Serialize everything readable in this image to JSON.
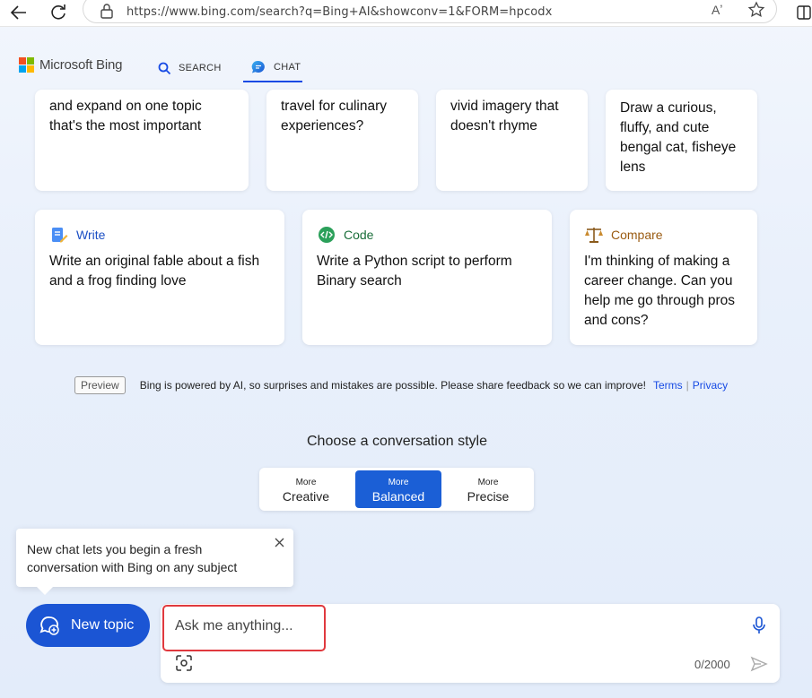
{
  "browser": {
    "url": "https://www.bing.com/search?q=Bing+AI&showconv=1&FORM=hpcodx",
    "read_aloud": "Aʼ"
  },
  "header": {
    "logo_text": "Microsoft Bing",
    "tabs": [
      {
        "label": "SEARCH"
      },
      {
        "label": "CHAT"
      }
    ]
  },
  "cards_top": [
    {
      "text": "and expand on one topic that's the most important"
    },
    {
      "text": "travel for culinary experiences?"
    },
    {
      "text": "vivid imagery that doesn't rhyme"
    },
    {
      "text": "Draw a curious, fluffy, and cute bengal cat, fisheye lens"
    }
  ],
  "cards": [
    {
      "category": "Write",
      "category_color": "#1b4fc4",
      "text": "Write an original fable about a fish and a frog finding love"
    },
    {
      "category": "Code",
      "category_color": "#1a6e3a",
      "text": "Write a Python script to perform Binary search"
    },
    {
      "category": "Compare",
      "category_color": "#9a5b12",
      "text": "I'm thinking of making a career change. Can you help me go through pros and cons?"
    }
  ],
  "disclaimer": {
    "badge": "Preview",
    "text": "Bing is powered by AI, so surprises and mistakes are possible. Please share feedback so we can improve!",
    "terms": "Terms",
    "privacy": "Privacy"
  },
  "conversation_style": {
    "title": "Choose a conversation style",
    "options": [
      {
        "more": "More",
        "name": "Creative"
      },
      {
        "more": "More",
        "name": "Balanced"
      },
      {
        "more": "More",
        "name": "Precise"
      }
    ],
    "selected": "Balanced"
  },
  "tooltip": {
    "text": "New chat lets you begin a fresh conversation with Bing on any subject"
  },
  "new_topic": {
    "label": "New topic"
  },
  "input": {
    "placeholder": "Ask me anything...",
    "counter": "0/2000"
  },
  "colors": {
    "accent": "#1b55d4",
    "highlight": "#e0393e"
  }
}
